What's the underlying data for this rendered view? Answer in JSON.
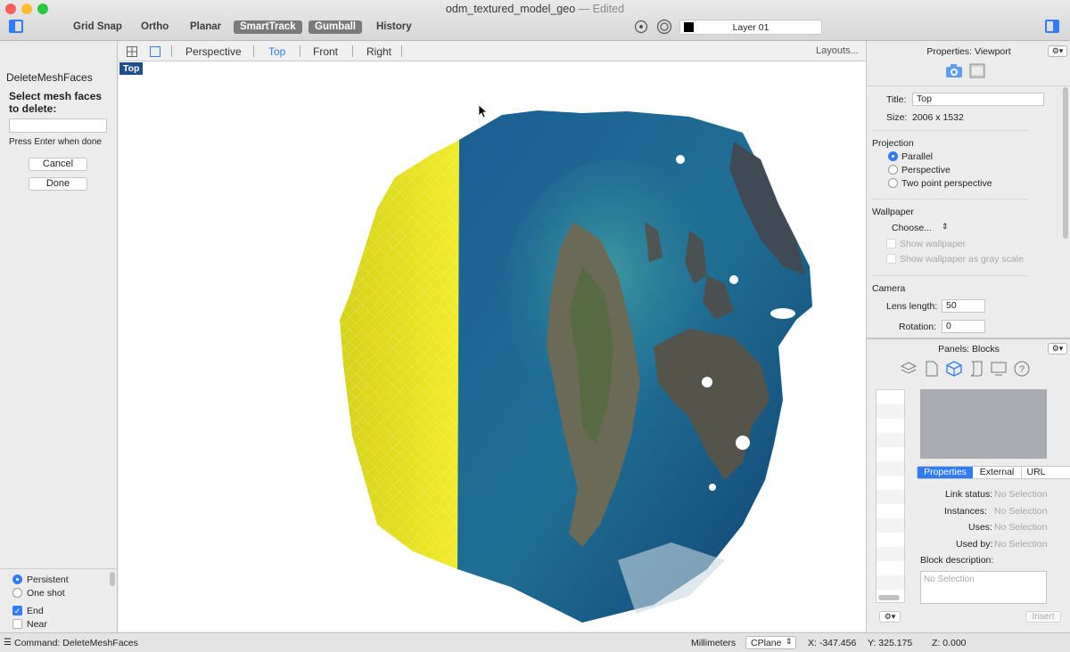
{
  "window": {
    "title": "odm_textured_model_geo",
    "status": " — Edited",
    "colors": {
      "close": "#fe5f57",
      "minimize": "#febc2e",
      "zoom": "#28c840"
    }
  },
  "toolbar": {
    "buttons": [
      "Grid Snap",
      "Ortho",
      "Planar",
      "SmartTrack",
      "Gumball",
      "History"
    ],
    "layer": "Layer 01"
  },
  "command_panel": {
    "title": "DeleteMeshFaces",
    "prompt": "Select mesh faces to delete:",
    "input_value": "",
    "hint": "Press Enter when done",
    "cancel": "Cancel",
    "done": "Done",
    "options": {
      "persistent": "Persistent",
      "one_shot": "One shot",
      "end": "End",
      "near": "Near"
    }
  },
  "viewport_tabs": {
    "tabs": [
      "Perspective",
      "Top",
      "Front",
      "Right"
    ],
    "active": "Top",
    "layouts": "Layouts..."
  },
  "viewport": {
    "label": "Top",
    "content": "textured aerial mesh model of islands with yellow wireframe section"
  },
  "properties": {
    "header": "Properties: Viewport",
    "title_label": "Title:",
    "title_value": "Top",
    "size_label": "Size:",
    "size_value": "2006 x 1532",
    "projection_header": "Projection",
    "projection_options": [
      "Parallel",
      "Perspective",
      "Two point perspective"
    ],
    "projection_selected": "Parallel",
    "wallpaper_header": "Wallpaper",
    "wallpaper_choose": "Choose...",
    "show_wallpaper": "Show wallpaper",
    "show_wallpaper_gray": "Show wallpaper as gray scale",
    "camera_header": "Camera",
    "lens_label": "Lens length:",
    "lens_value": "50",
    "rotation_label": "Rotation:",
    "rotation_value": "0"
  },
  "blocks": {
    "header": "Panels: Blocks",
    "tabs": [
      "Properties",
      "External",
      "URL"
    ],
    "active_tab": "Properties",
    "link_status_label": "Link status:",
    "instances_label": "Instances:",
    "uses_label": "Uses:",
    "used_by_label": "Used by:",
    "no_selection": "No Selection",
    "description_label": "Block description:",
    "insert": "Insert"
  },
  "statusbar": {
    "command": "Command: DeleteMeshFaces",
    "units": "Millimeters",
    "cplane": "CPlane",
    "x": "X: -347.456",
    "y": "Y: 325.175",
    "z": "Z: 0.000"
  },
  "accent": "#2f7cf6"
}
